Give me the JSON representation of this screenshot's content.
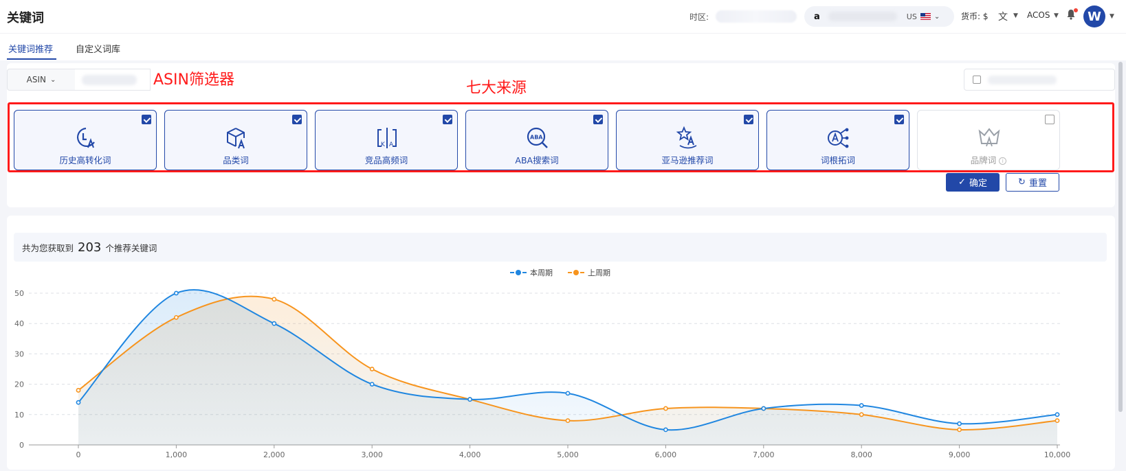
{
  "header": {
    "title": "关键词",
    "timezone_label": "时区:",
    "store_logo": "a",
    "region": "US",
    "currency_label": "货币:",
    "currency_value": "$",
    "metric": "ACOS",
    "avatar_letter": "W"
  },
  "tabs": [
    {
      "label": "关键词推荐",
      "active": true
    },
    {
      "label": "自定义词库",
      "active": false
    }
  ],
  "filter": {
    "type_select": "ASIN",
    "annotation_asin": "ASIN筛选器",
    "annotation_sources": "七大来源",
    "sources": [
      {
        "label": "历史高转化词",
        "icon": "history-conversion-icon",
        "checked": true
      },
      {
        "label": "品类词",
        "icon": "category-box-icon",
        "checked": true
      },
      {
        "label": "竞品高频词",
        "icon": "competitor-compare-icon",
        "checked": true
      },
      {
        "label": "ABA搜索词",
        "icon": "aba-search-icon",
        "checked": true
      },
      {
        "label": "亚马逊推荐词",
        "icon": "amazon-star-icon",
        "checked": true
      },
      {
        "label": "词根拓词",
        "icon": "root-expand-icon",
        "checked": true
      },
      {
        "label": "品牌词",
        "icon": "brand-crown-icon",
        "checked": false
      }
    ],
    "confirm_label": "确定",
    "reset_label": "重置"
  },
  "result": {
    "summary_prefix": "共为您获取到",
    "count": "203",
    "summary_suffix": "个推荐关键词"
  },
  "chart_data": {
    "type": "line",
    "x": [
      0,
      1000,
      2000,
      3000,
      4000,
      5000,
      6000,
      7000,
      8000,
      9000,
      10000
    ],
    "x_tick_labels": [
      "0",
      "1,000",
      "2,000",
      "3,000",
      "4,000",
      "5,000",
      "6,000",
      "7,000",
      "8,000",
      "9,000",
      "10,000"
    ],
    "series": [
      {
        "name": "本周期",
        "color": "#1f86e0",
        "values": [
          14,
          50,
          40,
          20,
          15,
          17,
          5,
          12,
          13,
          7,
          10
        ]
      },
      {
        "name": "上周期",
        "color": "#f7941d",
        "values": [
          18,
          42,
          48,
          25,
          15,
          8,
          12,
          12,
          10,
          5,
          8
        ]
      }
    ],
    "ylim": [
      0,
      50
    ],
    "y_ticks": [
      0,
      10,
      20,
      30,
      40,
      50
    ],
    "grid": true,
    "legend_position": "top-center",
    "title": "",
    "xlabel": "",
    "ylabel": ""
  }
}
